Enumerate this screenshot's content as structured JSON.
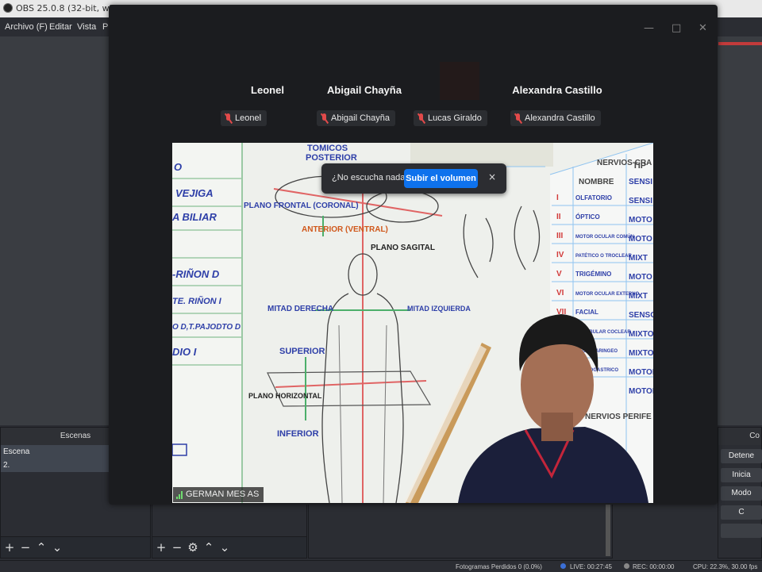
{
  "obs": {
    "title": "OBS 25.0.8 (32-bit, windows)",
    "menu": [
      "Archivo (F)",
      "Editar",
      "Vista",
      "P"
    ],
    "scenes_dock": {
      "header": "Escenas",
      "items": [
        "Escena",
        "2."
      ]
    },
    "controls_dock": {
      "header_partial": "Co",
      "buttons": [
        "Detene",
        "Inicia",
        "Modo",
        "C"
      ]
    },
    "statusbar": {
      "dropped_frames": "Fotogramas Perdidos 0 (0.0%)",
      "live": "LIVE: 00:27:45",
      "rec": "REC: 00:00:00",
      "cpu": "CPU: 22.3%, 30.00 fps"
    }
  },
  "meeting": {
    "participants": [
      {
        "display_name": "Leonel",
        "chip": "Leonel"
      },
      {
        "display_name": "Abigail Chayña",
        "chip": "Abigail Chayña"
      },
      {
        "display_name": "",
        "chip": "Lucas Giraldo"
      },
      {
        "display_name": "Alexandra Castillo",
        "chip": "Alexandra Castillo"
      }
    ],
    "audio_prompt": {
      "question": "¿No escucha nada?",
      "button": "Subir el volumen",
      "close": "×"
    },
    "speaker_name": "GERMAN MES AS",
    "window_controls": [
      "—",
      "□",
      "✕"
    ]
  },
  "whiteboard": {
    "left_panel": [
      "O",
      "VEJIGA",
      "A BILIAR",
      "-RIÑON D",
      "TE. RIÑON I",
      "O D,T.PAJODTO D",
      "DIO I"
    ],
    "center_labels": {
      "top": "TOMICOS",
      "posterior": "POSTERIOR",
      "plano_frontal": "PLANO FRONTAL (CORONAL)",
      "anterior": "ANTERIOR (VENTRAL)",
      "plano_sagital": "PLANO SAGITAL",
      "mitad_derecha": "MITAD DERECHA",
      "mitad_izquierda": "MITAD IZQUIERDA",
      "superior": "SUPERIOR",
      "plano_horizontal": "PLANO HORIZONTAL",
      "inferior": "INFERIOR"
    },
    "right_panel": {
      "header_a": "NERVIOS CRA",
      "col_nombre": "NOMBRE",
      "col_tipo": "TIP",
      "nerves": [
        "OLFATORIO",
        "ÓPTICO",
        "MOTOR OCULAR COMÚN",
        "PATÉTICO O TROCLEAR",
        "TRIGÉMINO",
        "MOTOR OCULAR EXTERNO",
        "FACIAL",
        "VESTIBULAR COCLEAR",
        "GLOSOFARINGEO",
        "NEUMOGASTRICO"
      ],
      "types": [
        "SENSI",
        "SENSI",
        "MOTO",
        "MOTO",
        "MIXT",
        "MOTO",
        "MIXT",
        "SENSO",
        "MIXTO",
        "MIXTO",
        "MOTOR",
        "MOTOR"
      ],
      "footer": "NERVIOS PERIFE"
    }
  }
}
